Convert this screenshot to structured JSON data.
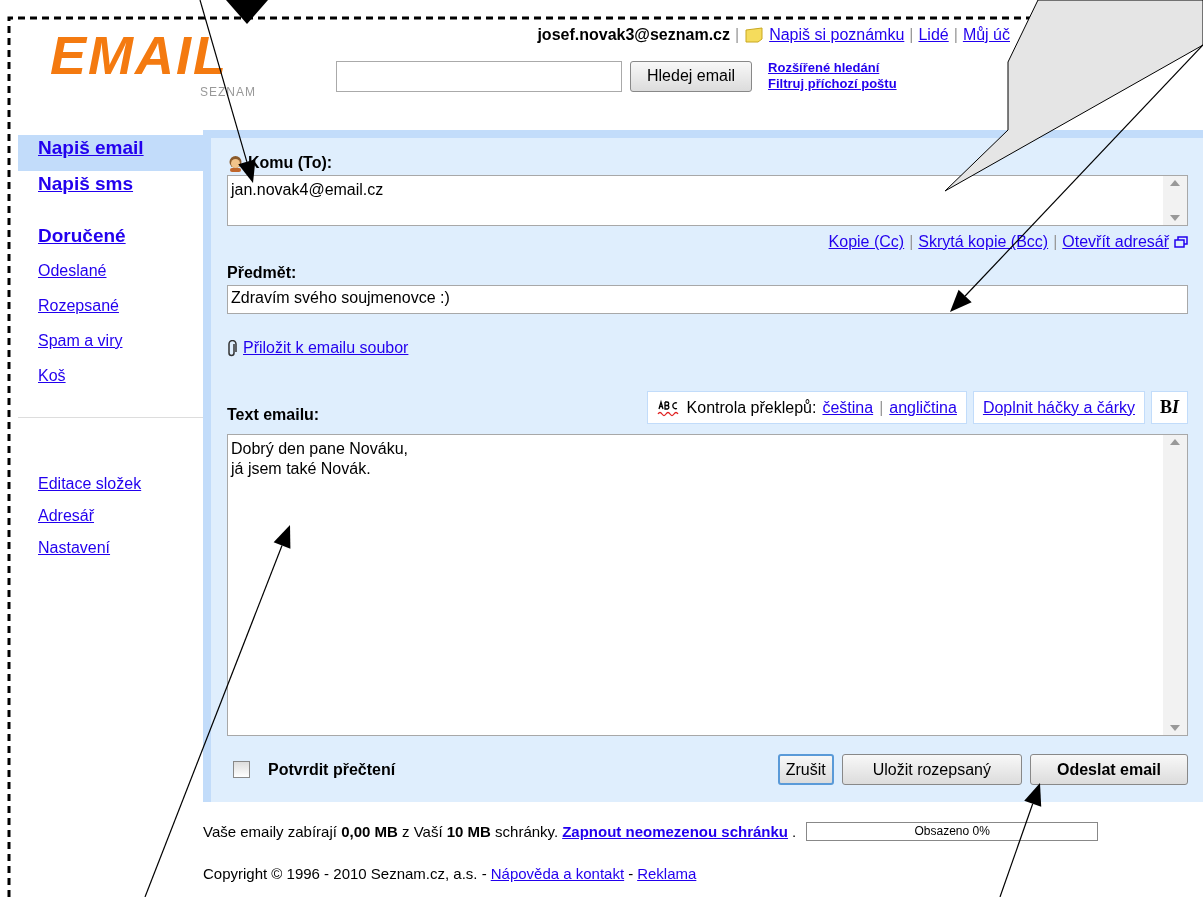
{
  "header": {
    "logo": {
      "text": "EMAIL",
      "subtext": "SEZNAM"
    },
    "account": "josef.novak3@seznam.cz",
    "separator": "|",
    "links": [
      {
        "label": "Napiš si poznámku",
        "kind": "note"
      },
      {
        "label": "Lidé",
        "kind": "plain"
      },
      {
        "label": "Můj úč",
        "kind": "plain"
      }
    ],
    "search": {
      "button": "Hledej email"
    },
    "search_links": [
      "Rozšířené hledání",
      "Filtruj příchozí poštu"
    ]
  },
  "sidebar": {
    "items": [
      {
        "label": "Napiš email",
        "kind": "major",
        "selected": true
      },
      {
        "label": "Napiš sms",
        "kind": "major",
        "selected": false
      },
      {
        "label": "Doručené",
        "kind": "major",
        "selected": false
      },
      {
        "label": "Odeslané",
        "kind": "minor",
        "selected": false
      },
      {
        "label": "Rozepsané",
        "kind": "minor",
        "selected": false
      },
      {
        "label": "Spam a viry",
        "kind": "minor",
        "selected": false
      },
      {
        "label": "Koš",
        "kind": "minor",
        "selected": false
      }
    ],
    "tools": [
      "Editace složek",
      "Adresář",
      "Nastavení"
    ]
  },
  "compose": {
    "to": {
      "label": "Komu (To):",
      "value": "jan.novak4@email.cz"
    },
    "recipient_links": [
      "Kopie (Cc)",
      "Skrytá kopie (Bcc)",
      "Otevřít adresář"
    ],
    "separator": "|",
    "subject": {
      "label": "Předmět:",
      "value": "Zdravím svého soujmenovce :)"
    },
    "attach": "Přiložit k emailu soubor",
    "body": {
      "label": "Text emailu:",
      "value": "Dobrý den pane Nováku,\njá jsem také Novák."
    },
    "spellcheck": {
      "label": "Kontrola překlepů:",
      "languages": [
        "čeština",
        "angličtina"
      ]
    },
    "diacritics": "Doplnit háčky a čárky",
    "format": {
      "bold": "B",
      "italic": "I"
    },
    "read_receipt": {
      "label": "Potvrdit přečtení",
      "checked": false
    },
    "buttons": [
      {
        "label": "Zrušit",
        "kind": "focused"
      },
      {
        "label": "Uložit rozepsaný",
        "kind": "normal"
      },
      {
        "label": "Odeslat email",
        "kind": "primary"
      }
    ]
  },
  "footer": {
    "storage": "Vaše emaily zabírají **0,00 MB** z Vaší **10 MB** schránky.",
    "storage_link": "Zapnout neomezenou schránku",
    "storage_end": ".",
    "meter": {
      "level": 0,
      "label": "Obsazeno 0%"
    },
    "copyright": "Copyright © 1996 - 2010 Seznam.cz, a.s. -",
    "links": [
      "Nápověda a kontakt",
      "Reklama"
    ],
    "separator": "-"
  }
}
